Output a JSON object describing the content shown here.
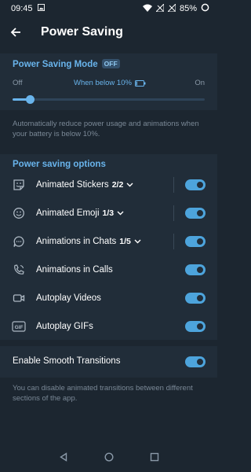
{
  "status_bar": {
    "time": "09:45",
    "battery": "85%"
  },
  "header": {
    "title": "Power Saving"
  },
  "power_saving_mode": {
    "title": "Power Saving Mode",
    "badge": "OFF",
    "slider": {
      "min_label": "Off",
      "max_label": "On",
      "current_label": "When below 10%",
      "value_percent": 10
    },
    "description": "Automatically reduce power usage and animations when your battery is below 10%."
  },
  "options": {
    "title": "Power saving options",
    "items": [
      {
        "label": "Animated Stickers",
        "count": "2/2",
        "icon": "sticker-icon",
        "expandable": true,
        "enabled": true
      },
      {
        "label": "Animated Emoji",
        "count": "1/3",
        "icon": "emoji-icon",
        "expandable": true,
        "enabled": true
      },
      {
        "label": "Animations in Chats",
        "count": "1/5",
        "icon": "chat-bubble-icon",
        "expandable": true,
        "enabled": true
      },
      {
        "label": "Animations in Calls",
        "count": "",
        "icon": "phone-icon",
        "expandable": false,
        "enabled": true
      },
      {
        "label": "Autoplay Videos",
        "count": "",
        "icon": "video-icon",
        "expandable": false,
        "enabled": true
      },
      {
        "label": "Autoplay GIFs",
        "count": "",
        "icon": "gif-icon",
        "expandable": false,
        "enabled": true
      }
    ]
  },
  "smooth_transitions": {
    "label": "Enable Smooth Transitions",
    "enabled": true,
    "description": "You can disable animated transitions between different sections of the app."
  },
  "colors": {
    "background": "#1c2630",
    "section": "#212d39",
    "accent": "#69b4ec",
    "toggle": "#4da4dc"
  }
}
